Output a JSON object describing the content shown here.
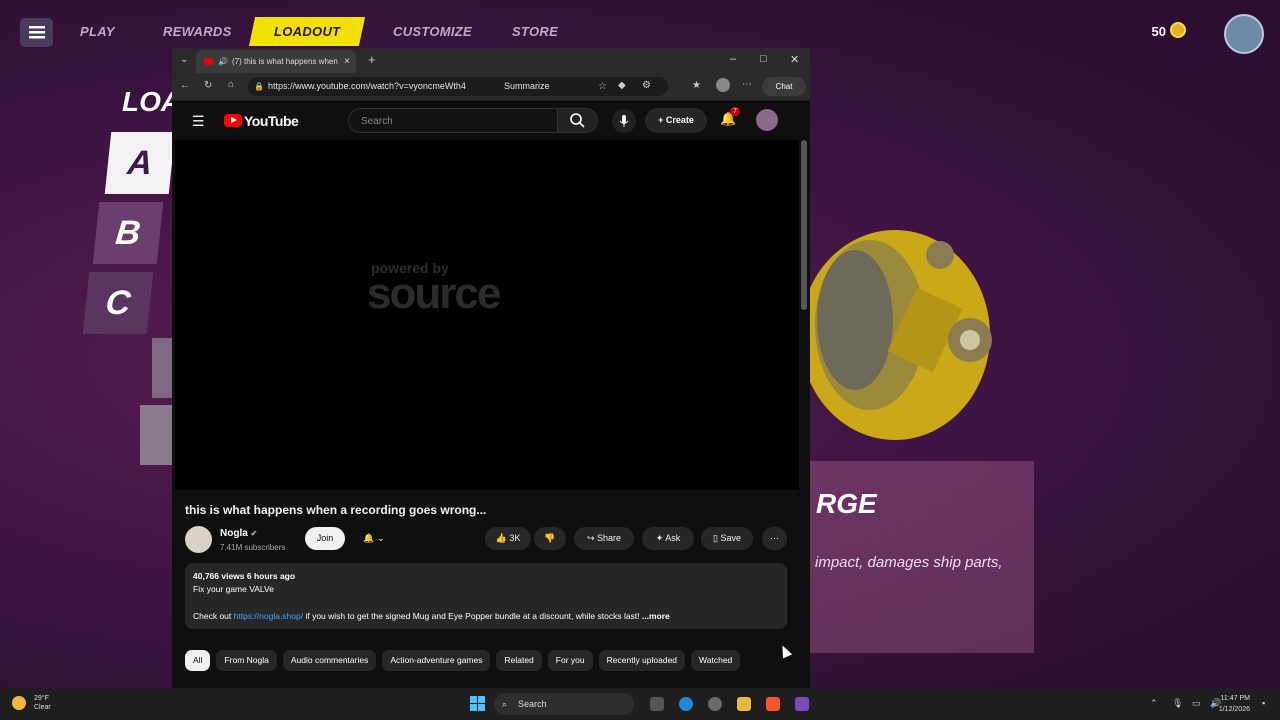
{
  "game": {
    "nav": [
      "PLAY",
      "REWARDS",
      "LOADOUT",
      "CUSTOMIZE",
      "STORE"
    ],
    "currency": "50",
    "loadout_title": "LOA",
    "slots": [
      "A",
      "B",
      "C"
    ],
    "part_name": "RGE",
    "part_desc": "impact, damages ship parts,"
  },
  "browser": {
    "tab_title": "(7) this is what happens when",
    "url": "https://www.youtube.com/watch?v=vyoncmeWth4",
    "summarize": "Summarize",
    "chat": "Chat"
  },
  "youtube": {
    "logo_text": "YouTube",
    "search_placeholder": "Search",
    "create": "Create",
    "notif_count": "7",
    "player_watermark_small": "powered by",
    "player_watermark_big": "source",
    "video_title": "this is what happens when a recording goes wrong...",
    "channel_name": "Nogla",
    "subscribers": "7.41M subscribers",
    "join": "Join",
    "likes": "3K",
    "share": "Share",
    "ask": "Ask",
    "save": "Save",
    "views_line": "40,766 views  6 hours ago",
    "desc_line2": "Fix your game VALVe",
    "desc_prefix": "Check out ",
    "desc_link": "https://nogla.shop/",
    "desc_suffix": " if you wish to get the signed Mug and Eye Popper bundle at a discount, while stocks last!",
    "desc_more": "...more",
    "chips": [
      "All",
      "From Nogla",
      "Audio commentaries",
      "Action-adventure games",
      "Related",
      "For you",
      "Recently uploaded",
      "Watched"
    ]
  },
  "taskbar": {
    "temp": "29°F",
    "condition": "Clear",
    "search": "Search",
    "time": "11:47 PM",
    "date": "1/12/2026"
  }
}
